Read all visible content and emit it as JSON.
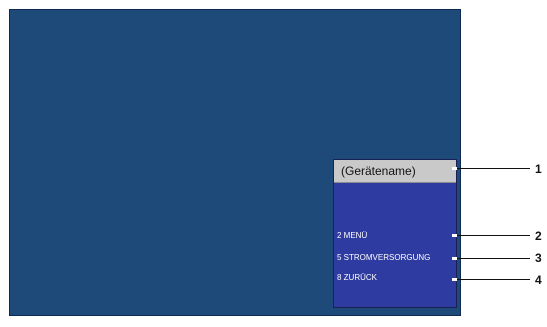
{
  "panel": {
    "header": "(Gerätename)",
    "items": [
      {
        "label": "2 MENÜ"
      },
      {
        "label": "5 STROMVERSORGUNG"
      },
      {
        "label": "8 ZURÜCK"
      }
    ]
  },
  "callouts": [
    "1",
    "2",
    "3",
    "4"
  ],
  "colors": {
    "screen_background": "#1e4a7a",
    "panel_background": "#2e3ba0",
    "header_background": "#c9c9c9"
  }
}
